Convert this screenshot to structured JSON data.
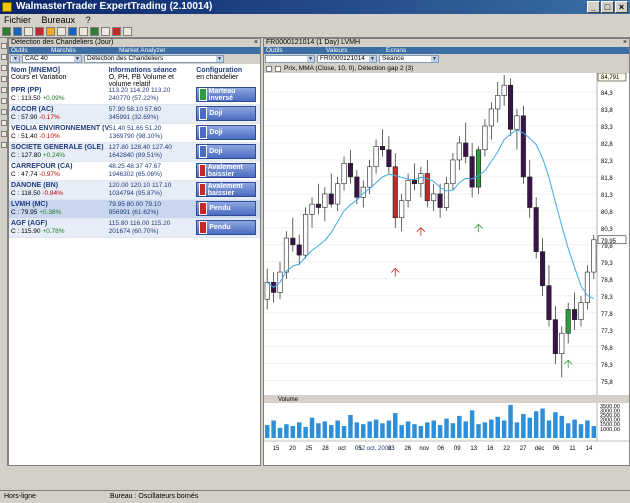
{
  "window": {
    "title": "WalmasterTrader ExpertTrading (2.10014)"
  },
  "menu": [
    "Fichier",
    "Bureaux",
    "?"
  ],
  "left_panel": {
    "title": "Détection des Chandeliers (Jour)",
    "tabs": [
      "Outils",
      "Marchés",
      "Market Analyzer"
    ],
    "market": "CAC 40",
    "analyzer": "Détection des Chandeliers",
    "header": {
      "col1_title": "Nom [MNEMO]",
      "col1_sub": "Cours et Variation",
      "col2_title": "Informations séance",
      "col2_sub": "O, PH, PB Volume et volume relatif",
      "col3_title": "Configuration",
      "col3_sub": "en chandelier"
    },
    "rows": [
      {
        "name": "PPR (PP)",
        "close": "C : 113.50",
        "var": "+0.09%",
        "var_dir": "pos",
        "ohl": "113.20 114.20 113.20",
        "vol": "240770 (57.22%)",
        "pattern": "Marteau inversé",
        "pat_color": "g"
      },
      {
        "name": "ACCOR (AC)",
        "close": "C : 57.90",
        "var": "-0.17%",
        "var_dir": "neg",
        "ohl": "57.90 58.10 57.60",
        "vol": "345991 (32.69%)",
        "pattern": "Doji",
        "pat_color": "b"
      },
      {
        "name": "VEOLIA ENVIRONNEMENT (VIE)",
        "close": "C : 51.40",
        "var": "-0.10%",
        "var_dir": "neg",
        "ohl": "51.40 51.65 51.20",
        "vol": "1369790 (98.10%)",
        "pattern": "Doji",
        "pat_color": "b"
      },
      {
        "name": "SOCIETE GENERALE (GLE)",
        "close": "C : 127.80",
        "var": "+0.24%",
        "var_dir": "pos",
        "ohl": "127.80 128.40 127.40",
        "vol": "1642840 (89.51%)",
        "pattern": "Doji",
        "pat_color": "b"
      },
      {
        "name": "CARREFOUR (CA)",
        "close": "C : 47.74",
        "var": "-0.97%",
        "var_dir": "neg",
        "ohl": "48.25 48.37 47.67",
        "vol": "1946302 (65.06%)",
        "pattern": "Avalement baissier",
        "pat_color": "r"
      },
      {
        "name": "DANONE (BN)",
        "close": "C : 118.50",
        "var": "-0.84%",
        "var_dir": "neg",
        "ohl": "120.00 120.10 117.10",
        "vol": "1034794 (95.87%)",
        "pattern": "Avalement baissier",
        "pat_color": "r"
      },
      {
        "name": "LVMH (MC)",
        "close": "C : 79.95",
        "var": "+0.38%",
        "var_dir": "pos",
        "ohl": "79.95 80.00 79.10",
        "vol": "956991 (61.62%)",
        "pattern": "Pendu",
        "pat_color": "r"
      },
      {
        "name": "AGF (AGF)",
        "close": "C : 115.90",
        "var": "+0.78%",
        "var_dir": "pos",
        "ohl": "115.80 116.00 115.20",
        "vol": "201674 (60.70%)",
        "pattern": "Pendu",
        "pat_color": "r"
      }
    ]
  },
  "right_panel": {
    "title": "FR0000121014 (1 Day) LVMH",
    "tabs": [
      "Outils",
      "Valeurs",
      "Ecrans"
    ],
    "valeur": "FR0000121014",
    "ecran": "Séance",
    "indicator_label": "Prix, MMA (Close, 10, 0), Détection gap 2 (3)",
    "volume_label": "Volume",
    "price_last": "84,791",
    "price_tag": "79.95",
    "price_axis": [
      "84,3",
      "83,8",
      "83,3",
      "82,8",
      "82,3",
      "81,8",
      "81,3",
      "80,8",
      "80,3",
      "79,8",
      "79,3",
      "78,8",
      "78,3",
      "77,8",
      "77,3",
      "76,8",
      "76,3",
      "75,8"
    ],
    "volume_axis": [
      "3500,00",
      "3000,00",
      "2500,00",
      "2000,00",
      "1500,00",
      "1000,00"
    ],
    "date_axis": [
      "15",
      "20",
      "25",
      "28",
      "oct",
      "05",
      "12 oct. 2006",
      "23",
      "26",
      "nov",
      "06",
      "09",
      "13",
      "16",
      "22",
      "27",
      "déc",
      "06",
      "11",
      "14"
    ]
  },
  "status": {
    "left": "Hors-ligne",
    "mid": "Bureau : Oscillateurs bornés"
  },
  "chart_data": {
    "type": "candlestick",
    "ylim": [
      75.5,
      84.8
    ],
    "candles": [
      [
        78.2,
        79.1,
        77.9,
        78.7
      ],
      [
        78.7,
        79.0,
        78.1,
        78.4
      ],
      [
        78.4,
        79.3,
        78.2,
        79.0
      ],
      [
        79.0,
        80.2,
        78.8,
        80.0
      ],
      [
        80.0,
        80.6,
        79.6,
        79.8
      ],
      [
        79.8,
        80.1,
        79.2,
        79.5
      ],
      [
        79.5,
        80.9,
        79.4,
        80.7
      ],
      [
        80.7,
        81.2,
        80.3,
        81.0
      ],
      [
        81.0,
        81.6,
        80.7,
        80.9
      ],
      [
        80.9,
        81.5,
        80.5,
        81.3
      ],
      [
        81.3,
        81.9,
        80.9,
        81.0
      ],
      [
        81.0,
        81.8,
        80.8,
        81.6
      ],
      [
        81.6,
        82.4,
        81.4,
        82.2
      ],
      [
        82.2,
        82.6,
        81.6,
        81.8
      ],
      [
        81.8,
        82.0,
        81.0,
        81.2
      ],
      [
        81.2,
        81.7,
        80.9,
        81.5
      ],
      [
        81.5,
        82.3,
        81.3,
        82.1
      ],
      [
        82.1,
        82.9,
        81.9,
        82.7
      ],
      [
        82.7,
        83.2,
        82.4,
        82.6
      ],
      [
        82.6,
        83.0,
        81.9,
        82.1
      ],
      [
        82.1,
        82.5,
        80.3,
        80.6
      ],
      [
        80.6,
        81.3,
        80.2,
        81.1
      ],
      [
        81.1,
        81.9,
        80.9,
        81.7
      ],
      [
        81.7,
        82.2,
        81.4,
        81.6
      ],
      [
        81.6,
        82.1,
        81.2,
        81.9
      ],
      [
        81.9,
        82.3,
        80.9,
        81.1
      ],
      [
        81.1,
        81.6,
        80.8,
        81.3
      ],
      [
        81.3,
        81.6,
        80.6,
        80.9
      ],
      [
        80.9,
        81.8,
        80.8,
        81.6
      ],
      [
        81.6,
        82.5,
        81.4,
        82.3
      ],
      [
        82.3,
        83.0,
        82.0,
        82.8
      ],
      [
        82.8,
        83.4,
        82.2,
        82.4
      ],
      [
        82.4,
        82.8,
        81.2,
        81.5
      ],
      [
        81.5,
        82.7,
        81.3,
        82.6
      ],
      [
        82.6,
        83.5,
        82.4,
        83.3
      ],
      [
        83.3,
        84.0,
        82.9,
        83.8
      ],
      [
        83.8,
        84.6,
        83.4,
        84.2
      ],
      [
        84.2,
        84.8,
        83.9,
        84.5
      ],
      [
        84.5,
        84.7,
        83.0,
        83.2
      ],
      [
        83.2,
        83.8,
        82.6,
        83.6
      ],
      [
        83.6,
        83.9,
        81.6,
        81.8
      ],
      [
        81.8,
        82.3,
        80.6,
        80.9
      ],
      [
        80.9,
        81.2,
        79.4,
        79.6
      ],
      [
        79.6,
        80.0,
        78.3,
        78.6
      ],
      [
        78.6,
        79.2,
        77.4,
        77.6
      ],
      [
        77.6,
        78.0,
        76.3,
        76.6
      ],
      [
        76.6,
        77.4,
        75.9,
        77.2
      ],
      [
        77.2,
        78.1,
        76.9,
        77.9
      ],
      [
        77.9,
        78.4,
        77.3,
        77.6
      ],
      [
        77.6,
        78.3,
        77.4,
        78.1
      ],
      [
        78.1,
        79.2,
        77.9,
        79.0
      ],
      [
        79.0,
        80.1,
        78.8,
        79.95
      ]
    ],
    "volume": [
      1400,
      1900,
      1100,
      1500,
      1300,
      1700,
      1200,
      2200,
      1600,
      1800,
      1400,
      1900,
      1300,
      2500,
      1700,
      1500,
      1800,
      2000,
      1600,
      1900,
      2700,
      1400,
      1800,
      1500,
      1300,
      1700,
      1900,
      1400,
      2100,
      1600,
      2400,
      1800,
      3000,
      1500,
      1700,
      2000,
      2300,
      1900,
      3600,
      1700,
      2600,
      2200,
      2900,
      3200,
      1900,
      2800,
      2400,
      1600,
      2000,
      1500,
      1900,
      1300
    ]
  }
}
